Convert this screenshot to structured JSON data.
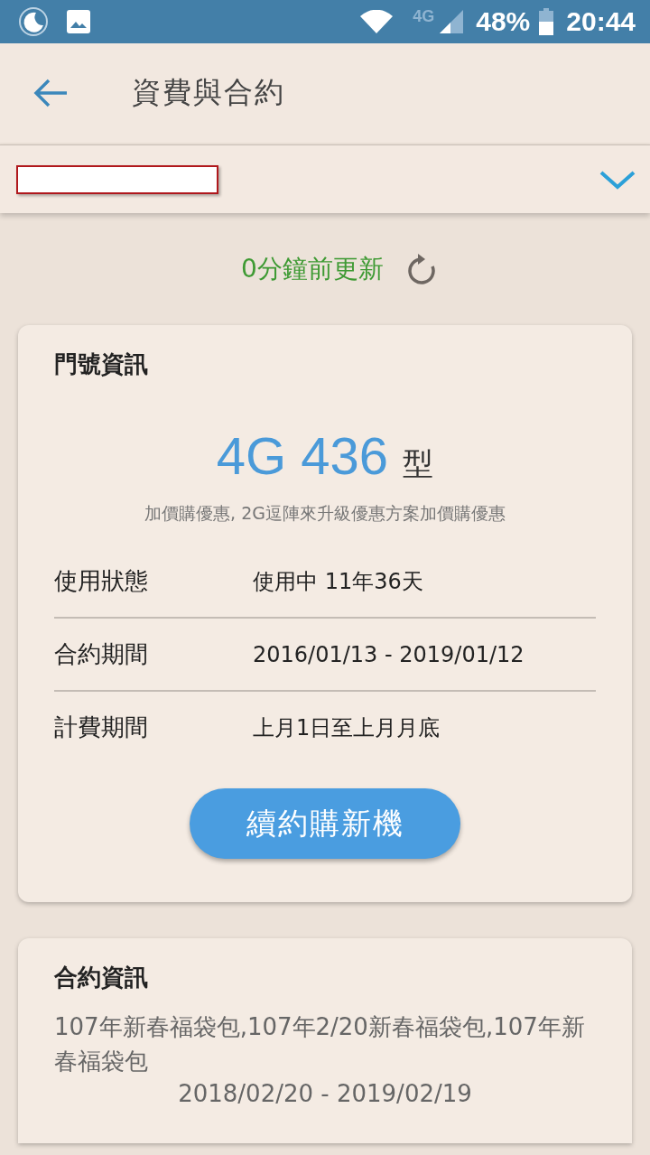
{
  "status_bar": {
    "battery": "48%",
    "time": "20:44",
    "network": "4G"
  },
  "app_bar": {
    "title": "資費與合約"
  },
  "line_picker": {
    "expanded": false
  },
  "update": {
    "text": "0分鐘前更新"
  },
  "plan_card": {
    "title": "門號資訊",
    "plan_name": "4G 436",
    "plan_suffix": "型",
    "plan_note": "加價購優惠, 2G逗陣來升級優惠方案加價購優惠",
    "rows": [
      {
        "label": "使用狀態",
        "value": "使用中 11年36天"
      },
      {
        "label": "合約期間",
        "value": "2016/01/13 - 2019/01/12"
      },
      {
        "label": "計費期間",
        "value": "上月1日至上月月底"
      }
    ],
    "button": "續約購新機"
  },
  "contract_card": {
    "title": "合約資訊",
    "description": "107年新春福袋包,107年2/20新春福袋包,107年新春福袋包",
    "period": "2018/02/20 - 2019/02/19"
  }
}
